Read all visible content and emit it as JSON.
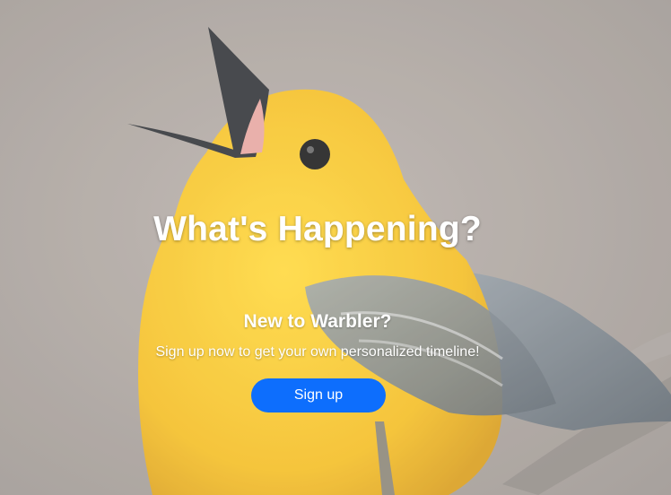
{
  "hero": {
    "headline": "What's Happening?",
    "subheading": "New to Warbler?",
    "tagline": "Sign up now to get your own personalized timeline!",
    "signup_label": "Sign up",
    "background_image": "yellow-warbler-singing"
  },
  "colors": {
    "button": "#0d6efd",
    "text": "#ffffff",
    "backdrop": "#a79f99",
    "bird_yellow": "#f7c52b",
    "wing_gray": "#7e8790"
  }
}
